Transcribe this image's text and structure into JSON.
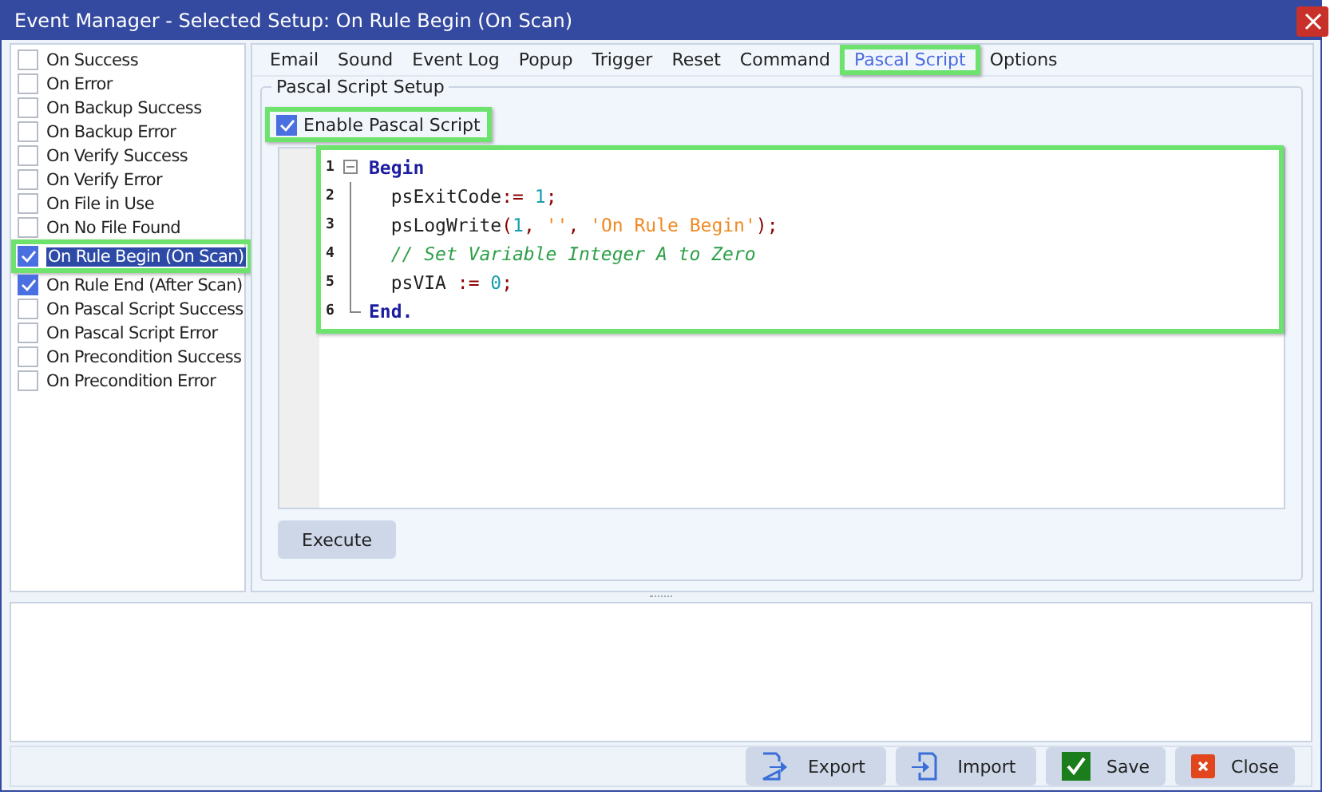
{
  "window": {
    "title": "Event Manager - Selected Setup: On Rule Begin (On Scan)"
  },
  "events": [
    {
      "label": "On Success",
      "checked": false,
      "selected": false,
      "highlighted": false
    },
    {
      "label": "On Error",
      "checked": false,
      "selected": false,
      "highlighted": false
    },
    {
      "label": "On Backup Success",
      "checked": false,
      "selected": false,
      "highlighted": false
    },
    {
      "label": "On Backup Error",
      "checked": false,
      "selected": false,
      "highlighted": false
    },
    {
      "label": "On Verify Success",
      "checked": false,
      "selected": false,
      "highlighted": false
    },
    {
      "label": "On Verify Error",
      "checked": false,
      "selected": false,
      "highlighted": false
    },
    {
      "label": "On File in Use",
      "checked": false,
      "selected": false,
      "highlighted": false
    },
    {
      "label": "On No File Found",
      "checked": false,
      "selected": false,
      "highlighted": false
    },
    {
      "label": "On Rule Begin (On Scan)",
      "checked": true,
      "selected": true,
      "highlighted": true
    },
    {
      "label": "On Rule End (After Scan)",
      "checked": true,
      "selected": false,
      "highlighted": false
    },
    {
      "label": "On Pascal Script Success",
      "checked": false,
      "selected": false,
      "highlighted": false
    },
    {
      "label": "On Pascal Script Error",
      "checked": false,
      "selected": false,
      "highlighted": false
    },
    {
      "label": "On Precondition Success",
      "checked": false,
      "selected": false,
      "highlighted": false
    },
    {
      "label": "On Precondition Error",
      "checked": false,
      "selected": false,
      "highlighted": false
    }
  ],
  "tabs": [
    {
      "label": "Email",
      "selected": false,
      "highlighted": false
    },
    {
      "label": "Sound",
      "selected": false,
      "highlighted": false
    },
    {
      "label": "Event Log",
      "selected": false,
      "highlighted": false
    },
    {
      "label": "Popup",
      "selected": false,
      "highlighted": false
    },
    {
      "label": "Trigger",
      "selected": false,
      "highlighted": false
    },
    {
      "label": "Reset",
      "selected": false,
      "highlighted": false
    },
    {
      "label": "Command",
      "selected": false,
      "highlighted": false
    },
    {
      "label": "Pascal Script",
      "selected": true,
      "highlighted": true
    },
    {
      "label": "Options",
      "selected": false,
      "highlighted": false
    }
  ],
  "group": {
    "title": "Pascal Script Setup",
    "enable": {
      "label": "Enable Pascal Script",
      "checked": true,
      "highlighted": true
    },
    "editor": {
      "highlighted": true,
      "lines": [
        {
          "number": "1",
          "tokens": [
            {
              "kind": "keyword",
              "text": "Begin"
            }
          ]
        },
        {
          "number": "2",
          "tokens": [
            {
              "kind": "ident",
              "text": "  psExitCode"
            },
            {
              "kind": "op",
              "text": ":="
            },
            {
              "kind": "number",
              "text": " 1"
            },
            {
              "kind": "op",
              "text": ";"
            }
          ]
        },
        {
          "number": "3",
          "tokens": [
            {
              "kind": "ident",
              "text": "  psLogWrite"
            },
            {
              "kind": "op",
              "text": "("
            },
            {
              "kind": "number",
              "text": "1"
            },
            {
              "kind": "op",
              "text": ", "
            },
            {
              "kind": "string",
              "text": "''"
            },
            {
              "kind": "op",
              "text": ", "
            },
            {
              "kind": "string",
              "text": "'On Rule Begin'"
            },
            {
              "kind": "op",
              "text": ");"
            }
          ]
        },
        {
          "number": "4",
          "tokens": [
            {
              "kind": "comment",
              "text": "  // Set Variable Integer A to Zero"
            }
          ]
        },
        {
          "number": "5",
          "tokens": [
            {
              "kind": "ident",
              "text": "  psVIA "
            },
            {
              "kind": "op",
              "text": ":="
            },
            {
              "kind": "number",
              "text": " 0"
            },
            {
              "kind": "op",
              "text": ";"
            }
          ]
        },
        {
          "number": "6",
          "tokens": [
            {
              "kind": "keyword",
              "text": "End."
            }
          ]
        }
      ]
    },
    "execute_button": "Execute"
  },
  "buttons": [
    {
      "kind": "export",
      "label": "Export"
    },
    {
      "kind": "import",
      "label": "Import"
    },
    {
      "kind": "save",
      "label": "Save"
    },
    {
      "kind": "close",
      "label": "Close"
    }
  ]
}
